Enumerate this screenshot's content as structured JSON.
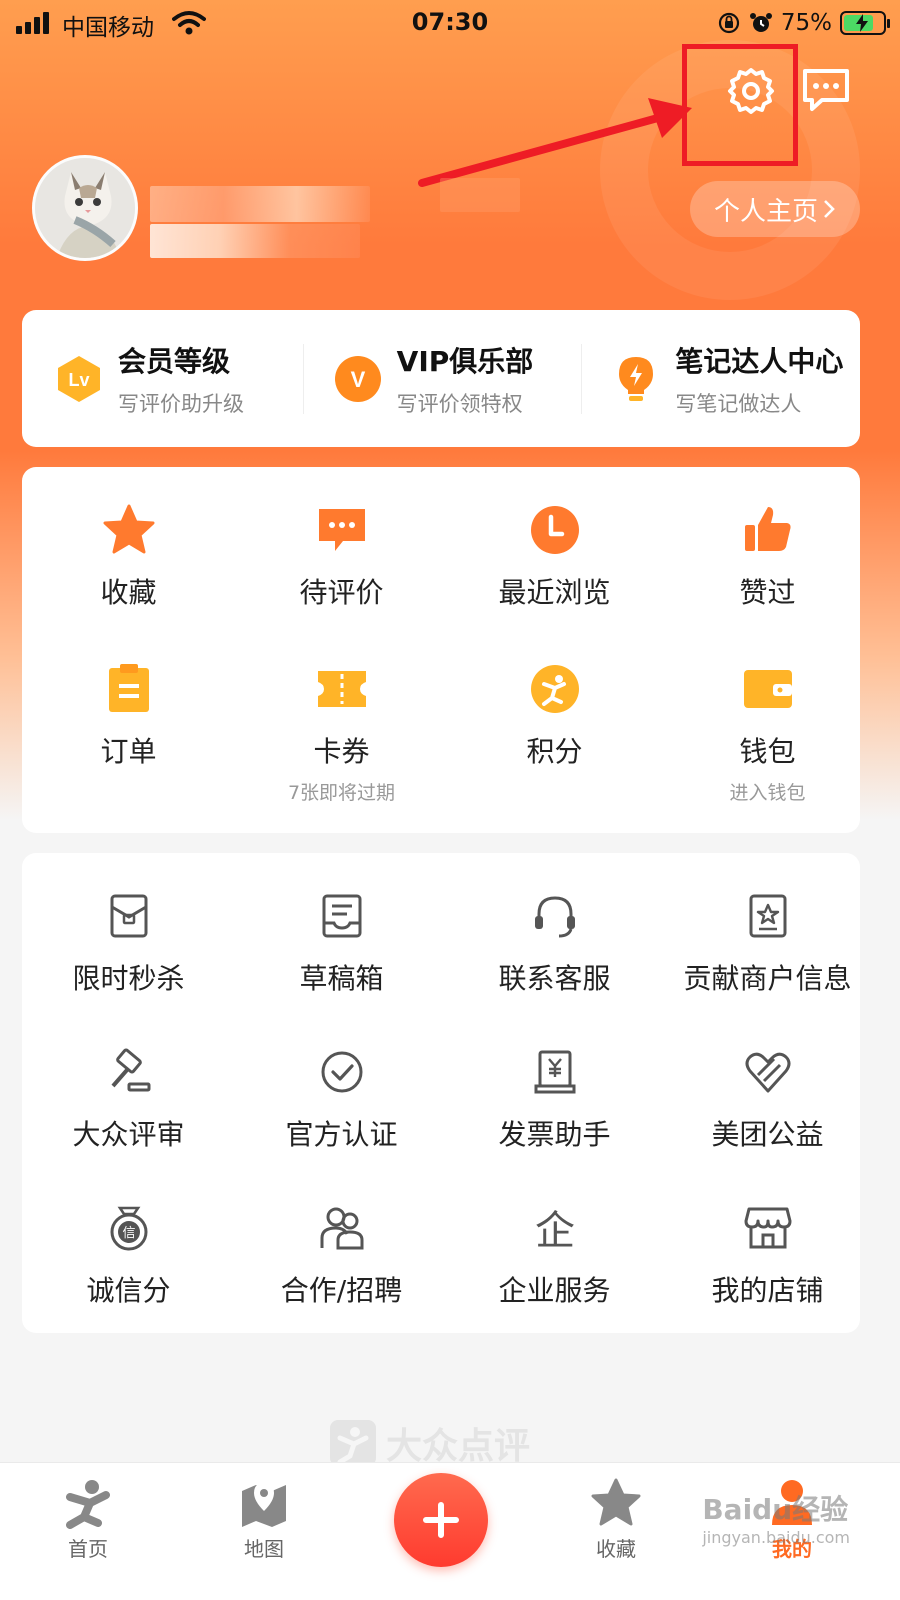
{
  "status_bar": {
    "carrier": "中国移动",
    "time": "07:30",
    "battery_percent": "75%",
    "battery_level": 0.75,
    "icons": [
      "signal-icon",
      "wifi-icon",
      "rotation-lock-icon",
      "alarm-icon",
      "battery-charging-icon"
    ]
  },
  "header": {
    "icons": [
      "settings-icon",
      "message-icon"
    ],
    "profile_link_label": "个人主页"
  },
  "member_card": {
    "items": [
      {
        "title": "会员等级",
        "subtitle": "写评价助升级",
        "icon": "lv-badge-icon",
        "icon_text": "Lv"
      },
      {
        "title": "VIP俱乐部",
        "subtitle": "写评价领特权",
        "icon": "vip-badge-icon",
        "icon_text": "V"
      },
      {
        "title": "笔记达人中心",
        "subtitle": "写笔记做达人",
        "icon": "lightbulb-icon"
      }
    ]
  },
  "quick_grid": {
    "items": [
      {
        "label": "收藏",
        "icon": "star-icon"
      },
      {
        "label": "待评价",
        "icon": "comment-icon"
      },
      {
        "label": "最近浏览",
        "icon": "clock-icon"
      },
      {
        "label": "赞过",
        "icon": "thumbs-up-icon"
      },
      {
        "label": "订单",
        "icon": "clipboard-icon"
      },
      {
        "label": "卡券",
        "icon": "ticket-icon",
        "sub": "7张即将过期"
      },
      {
        "label": "积分",
        "icon": "points-icon"
      },
      {
        "label": "钱包",
        "icon": "wallet-icon",
        "sub": "进入钱包"
      }
    ]
  },
  "services_grid": {
    "items": [
      {
        "label": "限时秒杀",
        "icon": "flash-sale-icon"
      },
      {
        "label": "草稿箱",
        "icon": "drafts-icon"
      },
      {
        "label": "联系客服",
        "icon": "headset-icon"
      },
      {
        "label": "贡献商户信息",
        "icon": "merchant-info-icon"
      },
      {
        "label": "大众评审",
        "icon": "gavel-icon"
      },
      {
        "label": "官方认证",
        "icon": "check-circle-icon"
      },
      {
        "label": "发票助手",
        "icon": "invoice-icon"
      },
      {
        "label": "美团公益",
        "icon": "heart-icon"
      },
      {
        "label": "诚信分",
        "icon": "credit-medal-icon",
        "icon_text": "信"
      },
      {
        "label": "合作/招聘",
        "icon": "people-icon"
      },
      {
        "label": "企业服务",
        "icon": "enterprise-icon",
        "icon_text": "企"
      },
      {
        "label": "我的店铺",
        "icon": "shop-icon"
      }
    ]
  },
  "watermark": {
    "text": "大众点评"
  },
  "tabbar": {
    "items": [
      {
        "label": "首页",
        "icon": "home-person-icon"
      },
      {
        "label": "地图",
        "icon": "map-icon"
      },
      {
        "label": "",
        "icon": "plus-icon"
      },
      {
        "label": "收藏",
        "icon": "star-icon"
      },
      {
        "label": "我的",
        "icon": "profile-icon",
        "active": true
      }
    ]
  },
  "overlay": {
    "baidu_watermark": "Baidu经验",
    "baidu_url": "jingyan.baidu.com"
  },
  "colors": {
    "accent": "#ff6a22",
    "highlight_red": "#ee1c25",
    "icon_orange": "#ff7a2e",
    "icon_yellow": "#ffb428"
  }
}
